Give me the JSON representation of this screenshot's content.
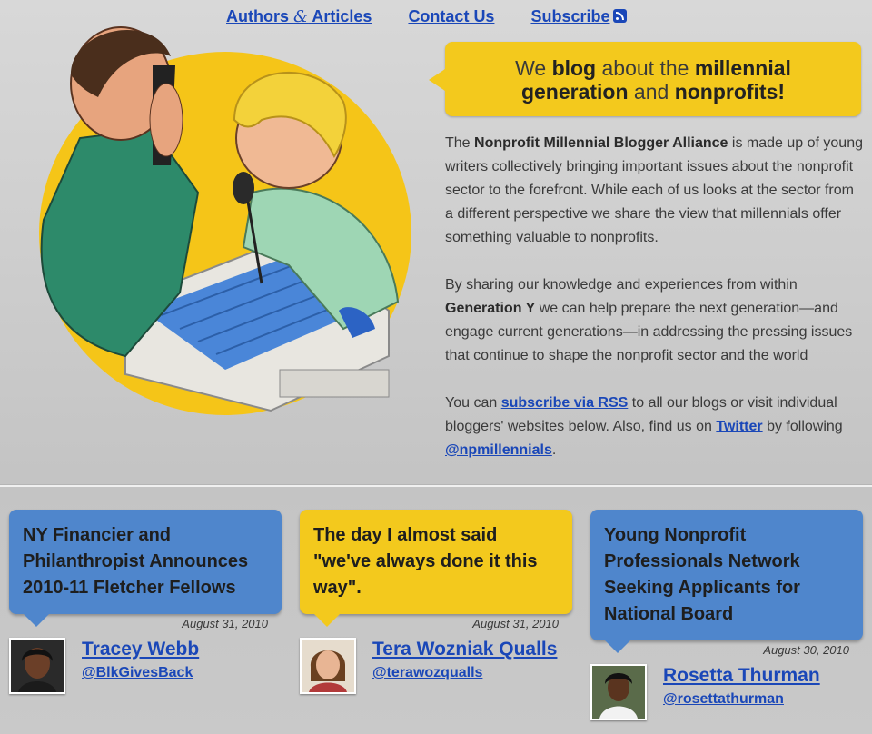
{
  "nav": {
    "authors_label": "Authors",
    "amp": "&",
    "articles_label": "Articles",
    "contact_label": "Contact Us",
    "subscribe_label": "Subscribe"
  },
  "tagline": {
    "we": "We",
    "blog": "blog",
    "about_the": "about the",
    "millennial": "millennial",
    "generation": "generation",
    "and": "and",
    "nonprofits": "nonprofits!"
  },
  "intro": {
    "p1_the": "The",
    "p1_bold": "Nonprofit Millennial Blogger Alliance",
    "p1_rest": "is made up of young writers collectively bringing important issues about the nonprofit sector to the forefront. While each of us looks at the sector from a different perspective we share the view that millennials offer something valuable to nonprofits.",
    "p2_start": "By sharing our knowledge and experiences from within",
    "p2_bold": "Generation Y",
    "p2_rest": "we can help prepare the next generation—and engage current generations—in addressing the pressing issues that continue to shape the nonprofit sector and the world",
    "p3_a": "You can",
    "p3_link_rss": "subscribe via RSS",
    "p3_b": "to all our blogs or visit individual bloggers' websites below. Also, find us on",
    "p3_link_twitter": "Twitter",
    "p3_c": "by following",
    "p3_link_handle": "@npmillennials",
    "p3_end": "."
  },
  "posts": [
    {
      "title": "NY Financier and Philanthropist Announces 2010-11 Fletcher Fellows",
      "date": "August 31, 2010",
      "author": "Tracey Webb",
      "handle": "@BlkGivesBack",
      "color": "#4f86cc"
    },
    {
      "title": "The day I almost said \"we've always done it this way\".",
      "date": "August 31, 2010",
      "author": "Tera Wozniak Qualls",
      "handle": "@terawozqualls",
      "color": "#f3c91d"
    },
    {
      "title": "Young Nonprofit Professionals Network Seeking Applicants for National Board",
      "date": "August 30, 2010",
      "author": "Rosetta Thurman",
      "handle": "@rosettathurman",
      "color": "#4f86cc"
    }
  ],
  "icons": {
    "rss": "rss-icon",
    "hero": "hero-illustration",
    "avatar": "avatar"
  }
}
